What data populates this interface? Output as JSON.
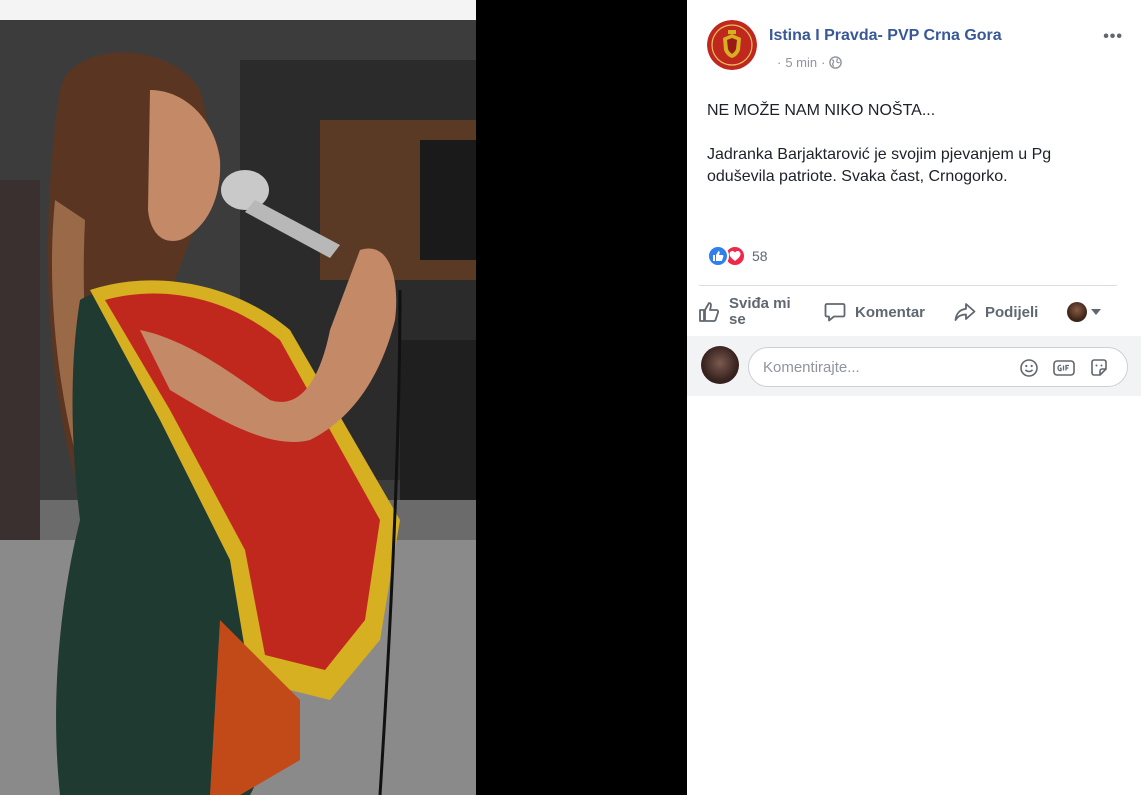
{
  "post": {
    "page_name": "Istina I Pravda- PVP Crna Gora",
    "time": "5 min",
    "separator": "·",
    "more": "•••",
    "paragraphs": [
      "NE MOŽE NAM NIKO NOŠTA...",
      "Jadranka Barjaktarović je svojim pjevanjem u Pg oduševila patriote. Svaka čast, Crnogorko."
    ],
    "reactions": {
      "types": [
        "like",
        "love"
      ],
      "count": "58"
    }
  },
  "actions": {
    "like_label": "Sviđa mi se",
    "comment_label": "Komentar",
    "share_label": "Podijeli"
  },
  "comment_box": {
    "placeholder": "Komentirajte..."
  },
  "colors": {
    "page_name": "#385898",
    "like_blue": "#2f7ff0",
    "love_red": "#f0284a",
    "action_gray": "#606770"
  }
}
